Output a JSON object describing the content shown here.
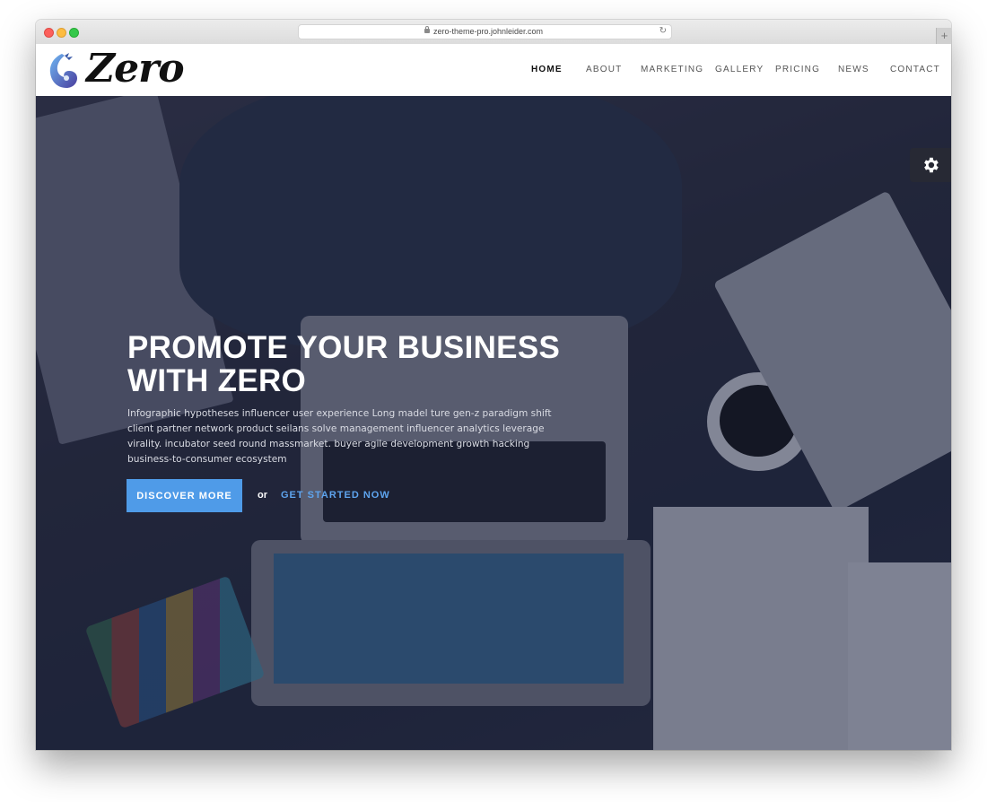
{
  "browser": {
    "url": "zero-theme-pro.johnleider.com",
    "new_tab_symbol": "+",
    "reload_symbol": "↻"
  },
  "site": {
    "logo_text": "Zero",
    "nav": [
      {
        "label": "HOME",
        "active": true
      },
      {
        "label": "ABOUT",
        "active": false
      },
      {
        "label": "MARKETING",
        "active": false
      },
      {
        "label": "GALLERY",
        "active": false
      },
      {
        "label": "PRICING",
        "active": false
      },
      {
        "label": "NEWS",
        "active": false
      },
      {
        "label": "CONTACT",
        "active": false
      }
    ]
  },
  "hero": {
    "title_line1": "PROMOTE YOUR BUSINESS",
    "title_line2": "WITH ZERO",
    "description": "Infographic hypotheses influencer user experience Long madel ture gen-z paradigm shift client partner network product seilans solve management influencer analytics leverage virality. incubator seed round massmarket. buyer agile development growth hacking business-to-consumer ecosystem",
    "primary_button": "DISCOVER MORE",
    "separator": "or",
    "secondary_link": "GET STARTED NOW"
  },
  "icons": {
    "settings": "gear-icon",
    "logo": "dragon-logo-icon",
    "lock": "lock-icon"
  },
  "colors": {
    "accent": "#4f9be8",
    "link": "#5ea4ee",
    "hero_overlay": "#191e3c"
  }
}
